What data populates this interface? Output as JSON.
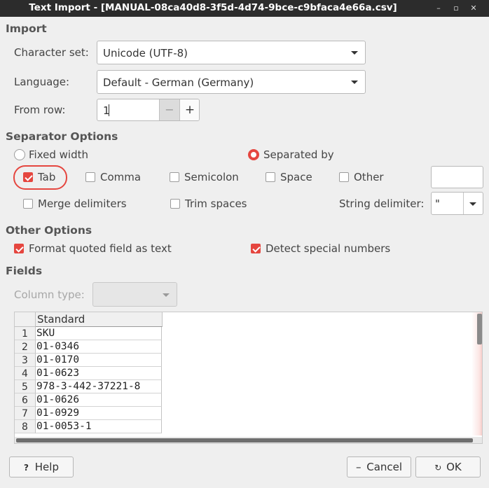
{
  "window": {
    "title": "Text Import - [MANUAL-08ca40d8-3f5d-4d74-9bce-c9bfaca4e66a.csv]",
    "controls": {
      "minimize": "–",
      "maximize": "▫",
      "close": "✕"
    }
  },
  "import": {
    "heading": "Import",
    "charset_label": "Character set:",
    "charset_value": "Unicode (UTF-8)",
    "language_label": "Language:",
    "language_value": "Default - German (Germany)",
    "from_row_label": "From row:",
    "from_row_value": "1",
    "minus": "−",
    "plus": "+"
  },
  "separator": {
    "heading": "Separator Options",
    "fixed_width": {
      "label": "Fixed width",
      "selected": false
    },
    "separated_by": {
      "label": "Separated by",
      "selected": true
    },
    "tab": {
      "label": "Tab",
      "checked": true
    },
    "comma": {
      "label": "Comma",
      "checked": false
    },
    "semicolon": {
      "label": "Semicolon",
      "checked": false
    },
    "space": {
      "label": "Space",
      "checked": false
    },
    "other": {
      "label": "Other",
      "checked": false,
      "value": ""
    },
    "merge": {
      "label": "Merge delimiters",
      "checked": false
    },
    "trim": {
      "label": "Trim spaces",
      "checked": false
    },
    "string_delim_label": "String delimiter:",
    "string_delim_value": "\""
  },
  "other_options": {
    "heading": "Other Options",
    "format_quoted": {
      "label": "Format quoted field as text",
      "checked": true
    },
    "detect_special": {
      "label": "Detect special numbers",
      "checked": true
    }
  },
  "fields": {
    "heading": "Fields",
    "column_type_label": "Column type:",
    "column_type_value": "",
    "column_header": "Standard",
    "rows": [
      {
        "num": "1",
        "value": "SKU"
      },
      {
        "num": "2",
        "value": "01-0346"
      },
      {
        "num": "3",
        "value": "01-0170"
      },
      {
        "num": "4",
        "value": "01-0623"
      },
      {
        "num": "5",
        "value": "978-3-442-37221-8"
      },
      {
        "num": "6",
        "value": "01-0626"
      },
      {
        "num": "7",
        "value": "01-0929"
      },
      {
        "num": "8",
        "value": "01-0053-1"
      }
    ]
  },
  "buttons": {
    "help": "Help",
    "help_icon": "?",
    "cancel": "Cancel",
    "cancel_icon": "–",
    "ok": "OK",
    "ok_icon": "↻"
  },
  "colors": {
    "accent": "#e5463f",
    "titlebar": "#2c2c2c",
    "background": "#efefef"
  }
}
